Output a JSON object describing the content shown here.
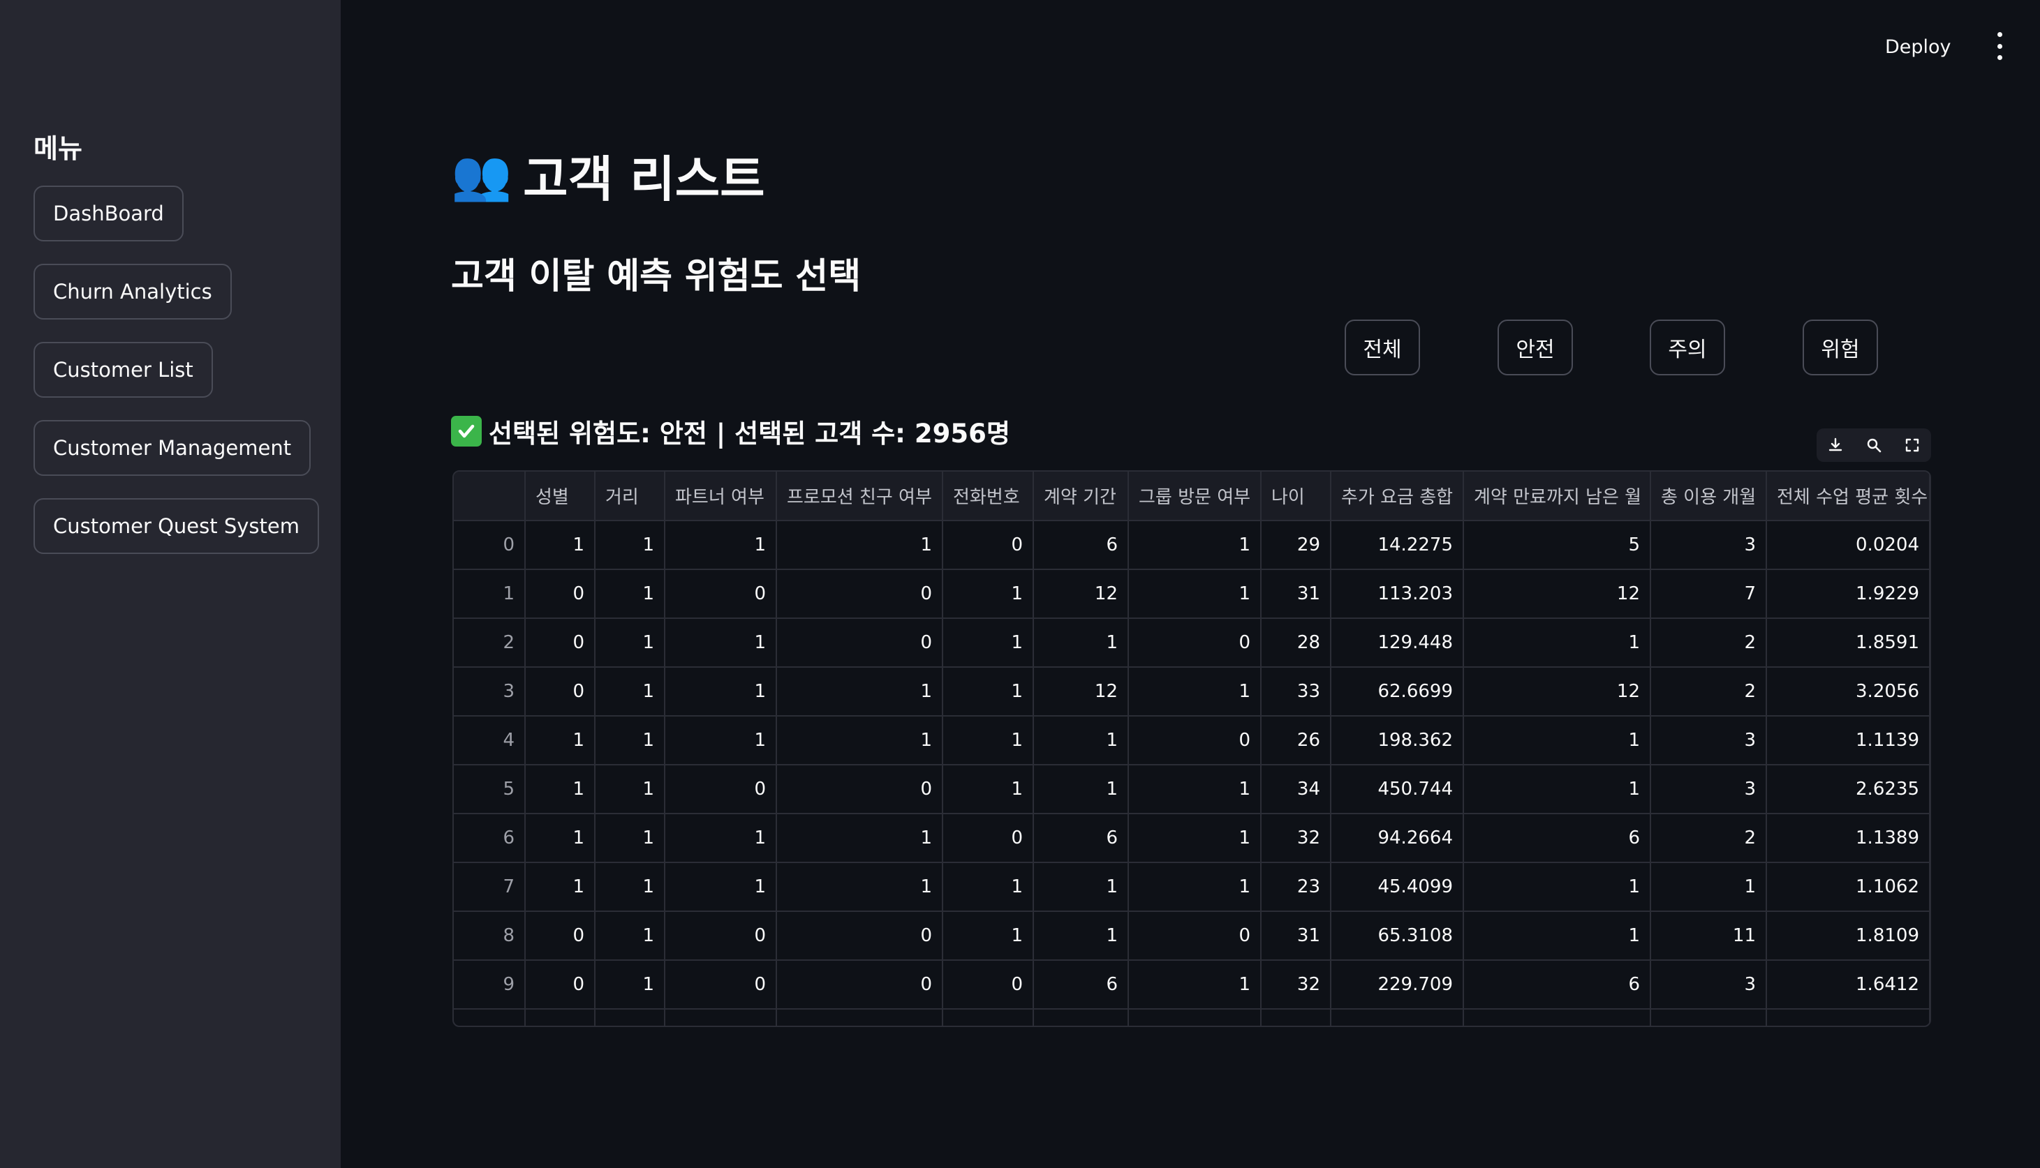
{
  "sidebar": {
    "title": "메뉴",
    "items": [
      {
        "label": "DashBoard"
      },
      {
        "label": "Churn Analytics"
      },
      {
        "label": "Customer List"
      },
      {
        "label": "Customer Management"
      },
      {
        "label": "Customer Quest System"
      }
    ]
  },
  "header": {
    "deploy_label": "Deploy",
    "menu_icon": "kebab-menu-icon"
  },
  "main": {
    "title_emoji": "👥",
    "title": "고객 리스트",
    "subtitle": "고객 이탈 예측 위험도 선택",
    "risk_buttons": [
      {
        "label": "전체"
      },
      {
        "label": "안전"
      },
      {
        "label": "주의"
      },
      {
        "label": "위험"
      }
    ],
    "status_icon": "check-mark-icon",
    "status_text": "선택된 위험도: 안전 | 선택된 고객 수: 2956명",
    "toolbar_icons": [
      "download-icon",
      "search-icon",
      "fullscreen-icon"
    ]
  },
  "table": {
    "columns": [
      "",
      "성별",
      "거리",
      "파트너 여부",
      "프로모션 친구 여부",
      "전화번호",
      "계약 기간",
      "그룹 방문 여부",
      "나이",
      "추가 요금 총합",
      "계약 만료까지 남은 월",
      "총 이용 개월",
      "전체 수업 평균 횟수"
    ],
    "rows": [
      [
        "0",
        "1",
        "1",
        "1",
        "1",
        "0",
        "6",
        "1",
        "29",
        "14.2275",
        "5",
        "3",
        "0.0204"
      ],
      [
        "1",
        "0",
        "1",
        "0",
        "0",
        "1",
        "12",
        "1",
        "31",
        "113.203",
        "12",
        "7",
        "1.9229"
      ],
      [
        "2",
        "0",
        "1",
        "1",
        "0",
        "1",
        "1",
        "0",
        "28",
        "129.448",
        "1",
        "2",
        "1.8591"
      ],
      [
        "3",
        "0",
        "1",
        "1",
        "1",
        "1",
        "12",
        "1",
        "33",
        "62.6699",
        "12",
        "2",
        "3.2056"
      ],
      [
        "4",
        "1",
        "1",
        "1",
        "1",
        "1",
        "1",
        "0",
        "26",
        "198.362",
        "1",
        "3",
        "1.1139"
      ],
      [
        "5",
        "1",
        "1",
        "0",
        "0",
        "1",
        "1",
        "1",
        "34",
        "450.744",
        "1",
        "3",
        "2.6235"
      ],
      [
        "6",
        "1",
        "1",
        "1",
        "1",
        "0",
        "6",
        "1",
        "32",
        "94.2664",
        "6",
        "2",
        "1.1389"
      ],
      [
        "7",
        "1",
        "1",
        "1",
        "1",
        "1",
        "1",
        "1",
        "23",
        "45.4099",
        "1",
        "1",
        "1.1062"
      ],
      [
        "8",
        "0",
        "1",
        "0",
        "0",
        "1",
        "1",
        "0",
        "31",
        "65.3108",
        "1",
        "11",
        "1.8109"
      ],
      [
        "9",
        "0",
        "1",
        "0",
        "0",
        "0",
        "6",
        "1",
        "32",
        "229.709",
        "6",
        "3",
        "1.6412"
      ]
    ]
  }
}
